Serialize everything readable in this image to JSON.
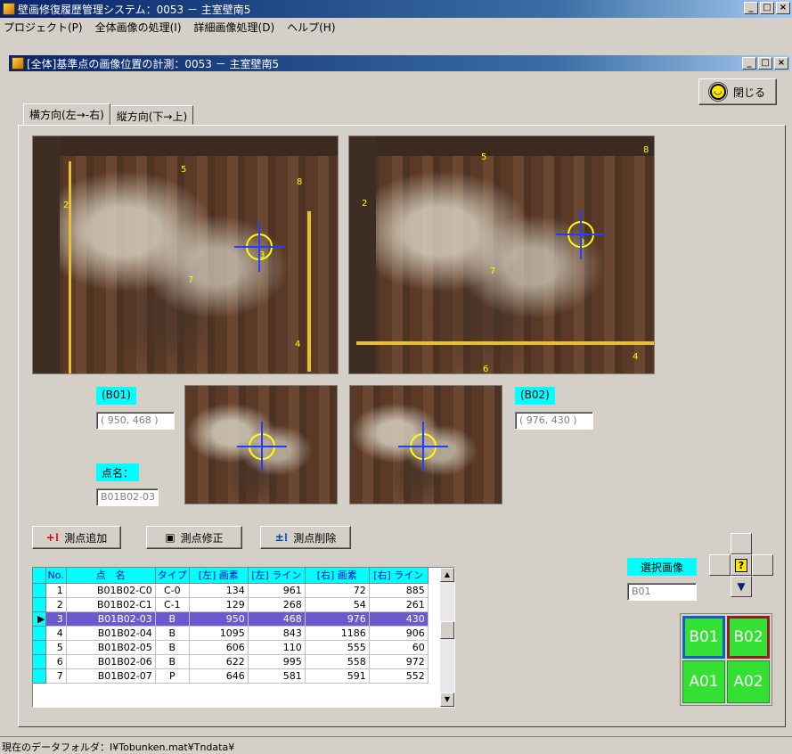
{
  "app": {
    "title": "壁画修復履歴管理システム：0053 － 主室壁南5",
    "menus": [
      "プロジェクト(P)",
      "全体画像の処理(I)",
      "詳細画像処理(D)",
      "ヘルプ(H)"
    ]
  },
  "child": {
    "title": "[全体]基準点の画像位置の計測：0053 － 主室壁南5",
    "close_label": "閉じる"
  },
  "tabs": [
    "横方向(左→-右)",
    "縦方向(下→上)"
  ],
  "photo_labels": {
    "left": [
      "5",
      "8",
      "2",
      "3",
      "7",
      "4"
    ],
    "right": [
      "5",
      "8",
      "2",
      "3",
      "7",
      "4",
      "6"
    ]
  },
  "left_image": {
    "tag": "(B01)",
    "coords": "( 950,  468 )"
  },
  "right_image": {
    "tag": "(B02)",
    "coords": "( 976,  430 )"
  },
  "point_name": {
    "label": "点名：",
    "value": "B01B02-03"
  },
  "buttons": {
    "add": "測点追加",
    "edit": "測点修正",
    "delete": "測点削除"
  },
  "table": {
    "headers": [
      "No.",
      "点　名",
      "タイプ",
      "[左] 画素",
      "[左] ライン",
      "[右] 画素",
      "[右] ライン"
    ],
    "rows": [
      [
        "1",
        "B01B02-C0",
        "C-0",
        "134",
        "961",
        "72",
        "885"
      ],
      [
        "2",
        "B01B02-C1",
        "C-1",
        "129",
        "268",
        "54",
        "261"
      ],
      [
        "3",
        "B01B02-03",
        "B",
        "950",
        "468",
        "976",
        "430"
      ],
      [
        "4",
        "B01B02-04",
        "B",
        "1095",
        "843",
        "1186",
        "906"
      ],
      [
        "5",
        "B01B02-05",
        "B",
        "606",
        "110",
        "555",
        "60"
      ],
      [
        "6",
        "B01B02-06",
        "B",
        "622",
        "995",
        "558",
        "972"
      ],
      [
        "7",
        "B01B02-07",
        "P",
        "646",
        "581",
        "591",
        "552"
      ]
    ],
    "selected_row": 3
  },
  "selection": {
    "label": "選択画像",
    "value": "B01"
  },
  "image_buttons": [
    "B01",
    "B02",
    "A01",
    "A02"
  ],
  "status": "現在のデータフォルダ：I¥Tobunken.mat¥Tndata¥",
  "colors": {
    "accent_cyan": "#00ffff",
    "selected_row": "#6a5acd",
    "image_button_green": "#33e033"
  }
}
